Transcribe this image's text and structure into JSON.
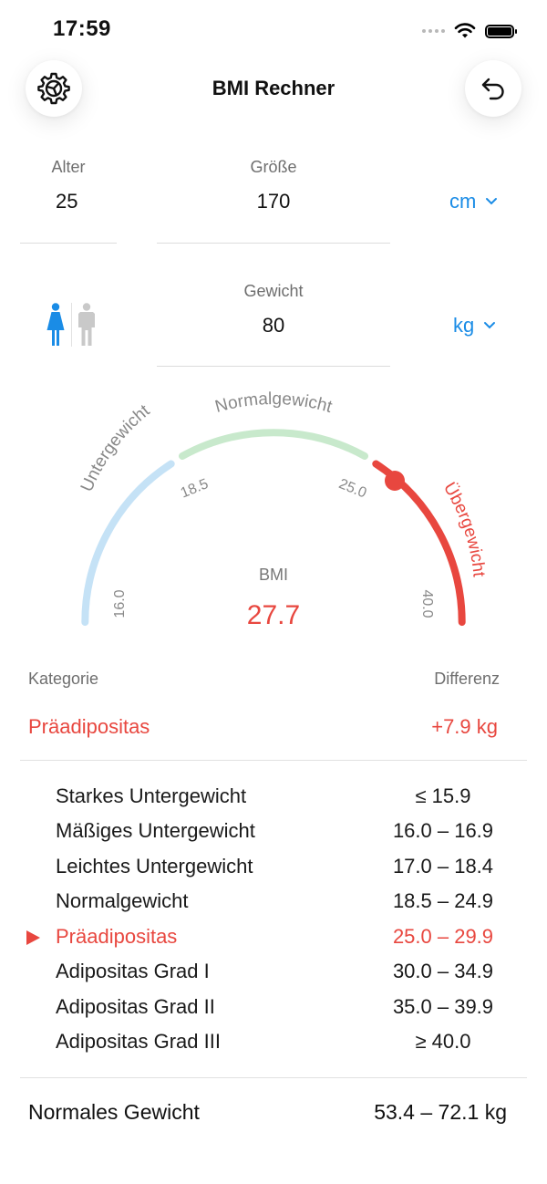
{
  "status": {
    "time": "17:59"
  },
  "header": {
    "title": "BMI Rechner",
    "settings_icon": "gear-icon",
    "back_icon": "undo-icon"
  },
  "inputs": {
    "age": {
      "label": "Alter",
      "value": "25"
    },
    "height": {
      "label": "Größe",
      "value": "170",
      "unit": "cm"
    },
    "weight": {
      "label": "Gewicht",
      "value": "80",
      "unit": "kg"
    },
    "gender": {
      "selected": "female"
    }
  },
  "gauge": {
    "labels": {
      "under": "Untergewicht",
      "normal": "Normalgewicht",
      "over": "Übergewicht"
    },
    "ticks": [
      "16.0",
      "18.5",
      "25.0",
      "40.0"
    ],
    "bmi_label": "BMI",
    "bmi_value": "27.7",
    "colors": {
      "under": "#c5e2f6",
      "normal": "#c8e9cc",
      "over": "#e8473f",
      "accent": "#1a8ce6"
    }
  },
  "result": {
    "category_header": "Kategorie",
    "difference_header": "Differenz",
    "category": "Präadipositas",
    "difference": "+7.9 kg"
  },
  "categories": [
    {
      "name": "Starkes Untergewicht",
      "range": "≤ 15.9"
    },
    {
      "name": "Mäßiges Untergewicht",
      "range": "16.0 – 16.9"
    },
    {
      "name": "Leichtes Untergewicht",
      "range": "17.0 – 18.4"
    },
    {
      "name": "Normalgewicht",
      "range": "18.5 – 24.9"
    },
    {
      "name": "Präadipositas",
      "range": "25.0 – 29.9"
    },
    {
      "name": "Adipositas Grad I",
      "range": "30.0 – 34.9"
    },
    {
      "name": "Adipositas Grad II",
      "range": "35.0 – 39.9"
    },
    {
      "name": "Adipositas Grad III",
      "range": "≥ 40.0"
    }
  ],
  "normal_weight": {
    "label": "Normales Gewicht",
    "value": "53.4 – 72.1 kg"
  }
}
